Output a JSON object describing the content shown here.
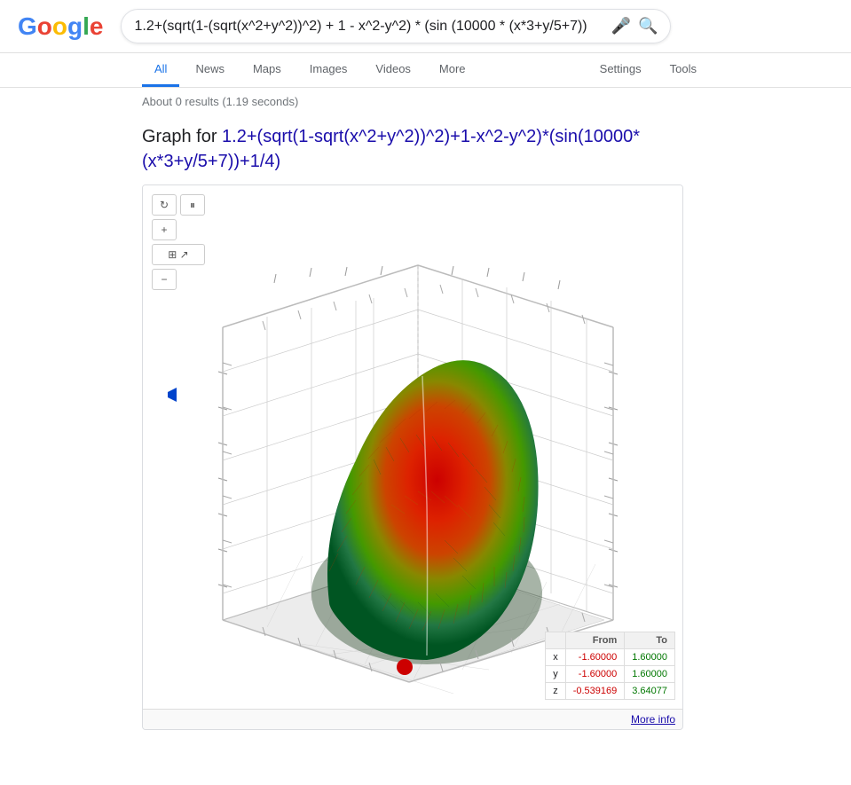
{
  "logo": {
    "letters": [
      "G",
      "o",
      "o",
      "g",
      "l",
      "e"
    ]
  },
  "search": {
    "query": "1.2+(sqrt(1-(sqrt(x^2+y^2))^2) + 1 - x^2-y^2) * (sin (10000 * (x*3+y/5+7))",
    "mic_title": "Search by voice",
    "glass_title": "Google Search"
  },
  "nav": {
    "tabs": [
      {
        "label": "All",
        "active": true
      },
      {
        "label": "News",
        "active": false
      },
      {
        "label": "Maps",
        "active": false
      },
      {
        "label": "Images",
        "active": false
      },
      {
        "label": "Videos",
        "active": false
      },
      {
        "label": "More",
        "active": false
      },
      {
        "label": "Settings",
        "active": false
      },
      {
        "label": "Tools",
        "active": false
      }
    ]
  },
  "results": {
    "info": "About 0 results (1.19 seconds)"
  },
  "graph": {
    "title_prefix": "Graph for ",
    "title_formula": "1.2+(sqrt(1-sqrt(x^2+y^2))^2)+1-x^2-y^2)*(sin(10000*(x*3+y/5+7))+1/4)",
    "controls": {
      "rotate": "↻",
      "pause": "⏸",
      "zoom_in": "+",
      "reset": "⊞",
      "zoom_out": "−"
    },
    "range_table": {
      "headers": [
        "",
        "From",
        "To"
      ],
      "rows": [
        {
          "label": "x",
          "from": "-1.60000",
          "to": "1.60000"
        },
        {
          "label": "y",
          "from": "-1.60000",
          "to": "1.60000"
        },
        {
          "label": "z",
          "from": "-0.539169",
          "to": "3.64077"
        }
      ]
    },
    "more_info": "More info"
  }
}
